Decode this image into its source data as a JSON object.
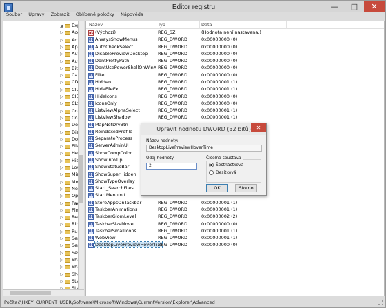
{
  "window": {
    "title": "Editor registru"
  },
  "menu": [
    "Soubor",
    "Úpravy",
    "Zobrazit",
    "Oblíbené položky",
    "Nápověda"
  ],
  "tree": {
    "items": [
      "Explore",
      "Acc",
      "Adv",
      "App",
      "Aut",
      "Aut",
      "BitE",
      "Cab",
      "CD",
      "CID",
      "CID",
      "CLS",
      "Cor",
      "Cor",
      "Des",
      "Dis",
      "Dor",
      "File",
      "Hel",
      "Hid",
      "Lov",
      "Mir",
      "Mo",
      "Nev",
      "Opt",
      "Pac",
      "Plm",
      "Rec",
      "Ribl",
      "Rur",
      "Sea",
      "Sea",
      "Ses",
      "Sha",
      "Sha",
      "She",
      "Star",
      "Star"
    ]
  },
  "list": {
    "columns": [
      "Název",
      "Typ",
      "Data"
    ],
    "rows": [
      {
        "name": "(Výchozí)",
        "type": "REG_SZ",
        "data": "(Hodnota není nastavena.)",
        "icon": "string-value-icon"
      },
      {
        "name": "AlwaysShowMenus",
        "type": "REG_DWORD",
        "data": "0x00000000 (0)",
        "icon": "dword-value-icon"
      },
      {
        "name": "AutoCheckSelect",
        "type": "REG_DWORD",
        "data": "0x00000000 (0)",
        "icon": "dword-value-icon"
      },
      {
        "name": "DisablePreviewDesktop",
        "type": "REG_DWORD",
        "data": "0x00000000 (0)",
        "icon": "dword-value-icon"
      },
      {
        "name": "DontPrettyPath",
        "type": "REG_DWORD",
        "data": "0x00000000 (0)",
        "icon": "dword-value-icon"
      },
      {
        "name": "DontUsePowerShellOnWinX",
        "type": "REG_DWORD",
        "data": "0x00000000 (0)",
        "icon": "dword-value-icon"
      },
      {
        "name": "Filter",
        "type": "REG_DWORD",
        "data": "0x00000000 (0)",
        "icon": "dword-value-icon"
      },
      {
        "name": "Hidden",
        "type": "REG_DWORD",
        "data": "0x00000001 (1)",
        "icon": "dword-value-icon"
      },
      {
        "name": "HideFileExt",
        "type": "REG_DWORD",
        "data": "0x00000001 (1)",
        "icon": "dword-value-icon"
      },
      {
        "name": "HideIcons",
        "type": "REG_DWORD",
        "data": "0x00000000 (0)",
        "icon": "dword-value-icon"
      },
      {
        "name": "IconsOnly",
        "type": "REG_DWORD",
        "data": "0x00000000 (0)",
        "icon": "dword-value-icon"
      },
      {
        "name": "ListviewAlphaSelect",
        "type": "REG_DWORD",
        "data": "0x00000001 (1)",
        "icon": "dword-value-icon"
      },
      {
        "name": "ListviewShadow",
        "type": "REG_DWORD",
        "data": "0x00000001 (1)",
        "icon": "dword-value-icon"
      },
      {
        "name": "MapNetDrvBtn",
        "type": "",
        "data": "",
        "icon": "dword-value-icon"
      },
      {
        "name": "ReindexedProfile",
        "type": "",
        "data": "",
        "icon": "dword-value-icon"
      },
      {
        "name": "SeparateProcess",
        "type": "",
        "data": "",
        "icon": "dword-value-icon"
      },
      {
        "name": "ServerAdminUI",
        "type": "",
        "data": "",
        "icon": "dword-value-icon"
      },
      {
        "name": "ShowCompColor",
        "type": "",
        "data": "",
        "icon": "dword-value-icon"
      },
      {
        "name": "ShowInfoTip",
        "type": "",
        "data": "",
        "icon": "dword-value-icon"
      },
      {
        "name": "ShowStatusBar",
        "type": "",
        "data": "",
        "icon": "dword-value-icon"
      },
      {
        "name": "ShowSuperHidden",
        "type": "",
        "data": "",
        "icon": "dword-value-icon"
      },
      {
        "name": "ShowTypeOverlay",
        "type": "",
        "data": "",
        "icon": "dword-value-icon"
      },
      {
        "name": "Start_SearchFiles",
        "type": "",
        "data": "",
        "icon": "dword-value-icon"
      },
      {
        "name": "StartMenuInit",
        "type": "",
        "data": "",
        "icon": "dword-value-icon"
      },
      {
        "name": "StoreAppsOnTaskbar",
        "type": "REG_DWORD",
        "data": "0x00000001 (1)",
        "icon": "dword-value-icon"
      },
      {
        "name": "TaskbarAnimations",
        "type": "REG_DWORD",
        "data": "0x00000001 (1)",
        "icon": "dword-value-icon"
      },
      {
        "name": "TaskbarGlomLevel",
        "type": "REG_DWORD",
        "data": "0x00000002 (2)",
        "icon": "dword-value-icon"
      },
      {
        "name": "TaskbarSizeMove",
        "type": "REG_DWORD",
        "data": "0x00000000 (0)",
        "icon": "dword-value-icon"
      },
      {
        "name": "TaskbarSmallIcons",
        "type": "REG_DWORD",
        "data": "0x00000001 (1)",
        "icon": "dword-value-icon"
      },
      {
        "name": "WebView",
        "type": "REG_DWORD",
        "data": "0x00000001 (1)",
        "icon": "dword-value-icon"
      },
      {
        "name": "DesktopLivePreviewHoverTi...",
        "type": "REG_DWORD",
        "data": "0x00000000 (0)",
        "icon": "dword-value-icon",
        "selected": true
      }
    ]
  },
  "status": {
    "path": "Počítač\\HKEY_CURRENT_USER\\Software\\Microsoft\\Windows\\CurrentVersion\\Explorer\\Advanced"
  },
  "dialog": {
    "title": "Upravit hodnotu DWORD (32 bitů)",
    "name_label": "Název hodnoty:",
    "name_value": "DesktopLivePreviewHoverTime",
    "data_label": "Údaj hodnoty:",
    "data_value": "2",
    "base_label": "Číselná soustava",
    "radio_hex": "Šestnáctková",
    "radio_dec": "Desítková",
    "ok": "OK",
    "cancel": "Storno"
  }
}
